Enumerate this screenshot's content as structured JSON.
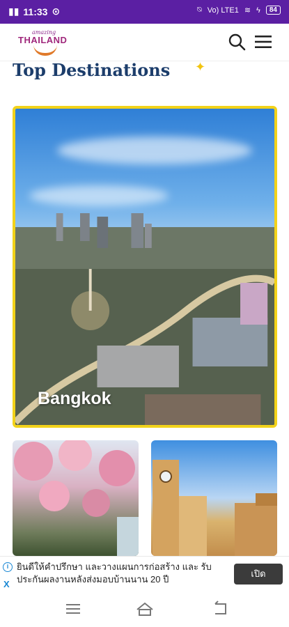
{
  "status": {
    "time": "11:33",
    "battery": "84",
    "network": "Vo) LTE1"
  },
  "header": {
    "logo_small": "amazing",
    "logo_big": "THAILAND"
  },
  "section": {
    "title": "Top Destinations"
  },
  "hero": {
    "label": "Bangkok"
  },
  "ad": {
    "text": "ยินดีให้คำปรึกษา และวางแผนการก่อสร้าง และ รับประกันผลงานหลังส่งมอบบ้านนาน 20 ปี",
    "button": "เปิด",
    "info": "i",
    "close": "X"
  },
  "colors": {
    "status_bar": "#5b1fa3",
    "title": "#1c3d6b",
    "hero_border": "#f2d21a"
  }
}
